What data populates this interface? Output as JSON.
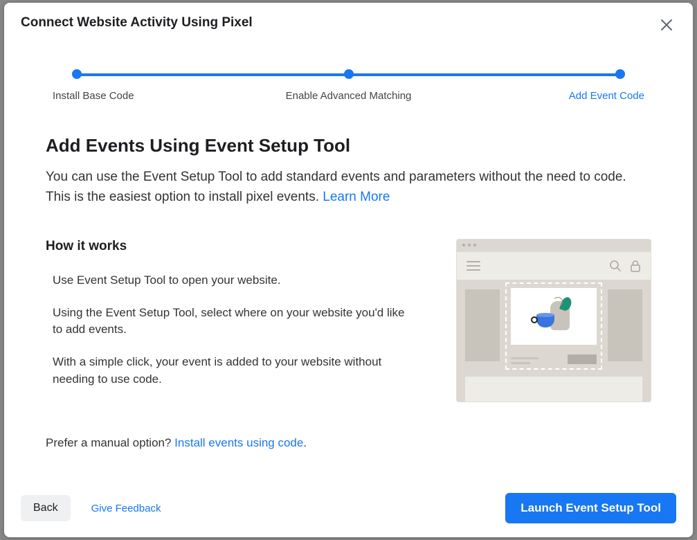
{
  "modal_title": "Connect Website Activity Using Pixel",
  "stepper": {
    "steps": [
      {
        "label": "Install Base Code",
        "active": false
      },
      {
        "label": "Enable Advanced Matching",
        "active": false
      },
      {
        "label": "Add Event Code",
        "active": true
      }
    ]
  },
  "page_title": "Add Events Using Event Setup Tool",
  "page_desc": "You can use the Event Setup Tool to add standard events and parameters without the need to code. This is the easiest option to install pixel events. ",
  "learn_more": "Learn More",
  "how_it_works_heading": "How it works",
  "how_it_works": [
    "Use Event Setup Tool to open your website.",
    "Using the Event Setup Tool, select where on your website you'd like to add events.",
    "With a simple click, your event is added to your website without needing to use code."
  ],
  "manual_prefix": "Prefer a manual option? ",
  "manual_link": "Install events using code",
  "manual_suffix": ".",
  "footer": {
    "back": "Back",
    "feedback": "Give Feedback",
    "primary": "Launch Event Setup Tool"
  }
}
